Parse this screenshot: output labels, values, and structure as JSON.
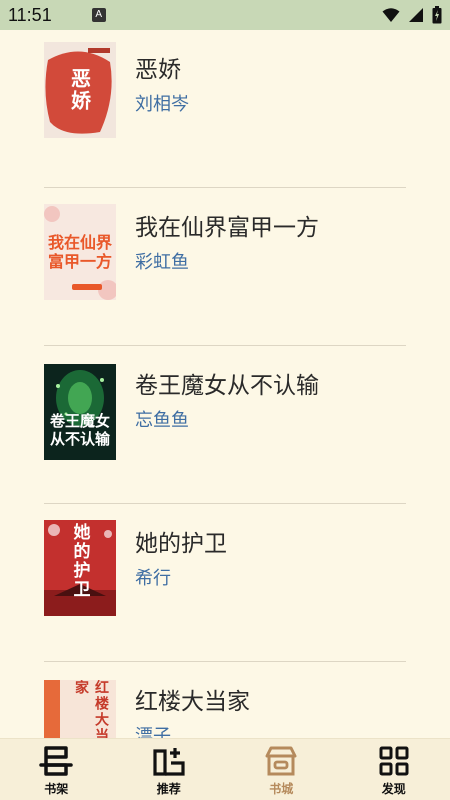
{
  "status": {
    "time": "11:51",
    "indicator": "A"
  },
  "books": [
    {
      "title": "恶娇",
      "author": "刘相岑",
      "cover_text": "恶娇",
      "cover_bg": "#d24a3a",
      "cover_fg": "#ffffff",
      "cover_base": "#f3e3d6"
    },
    {
      "title": "我在仙界富甲一方",
      "author": "彩虹鱼",
      "cover_text": "我在仙界富甲一方",
      "cover_bg": "#f6e4dc",
      "cover_fg": "#e9582a",
      "cover_base": "#f6e4dc"
    },
    {
      "title": "卷王魔女从不认输",
      "author": "忘鱼鱼",
      "cover_text": "卷王魔女从不认输",
      "cover_bg": "#0e2a22",
      "cover_fg": "#ffffff",
      "cover_base": "#1f6b3a"
    },
    {
      "title": "她的护卫",
      "author": "希行",
      "cover_text": "她的护卫",
      "cover_bg": "#c3302e",
      "cover_fg": "#ffffff",
      "cover_base": "#8c1c1c"
    },
    {
      "title": "红楼大当家",
      "author": "漂子",
      "cover_text": "红楼大当家",
      "cover_bg": "#f7e2d2",
      "cover_fg": "#c53a2a",
      "cover_base": "#e66a3a"
    }
  ],
  "tabs": [
    {
      "label": "书架",
      "icon": "bookshelf-icon",
      "active": false
    },
    {
      "label": "推荐",
      "icon": "recommend-icon",
      "active": false
    },
    {
      "label": "书城",
      "icon": "bookstore-icon",
      "active": true
    },
    {
      "label": "发现",
      "icon": "discover-icon",
      "active": false
    }
  ],
  "colors": {
    "background": "#fdf8e6",
    "statusbar": "#c8d8b6",
    "author": "#3f6ea3",
    "active_tab": "#b58a5c"
  }
}
